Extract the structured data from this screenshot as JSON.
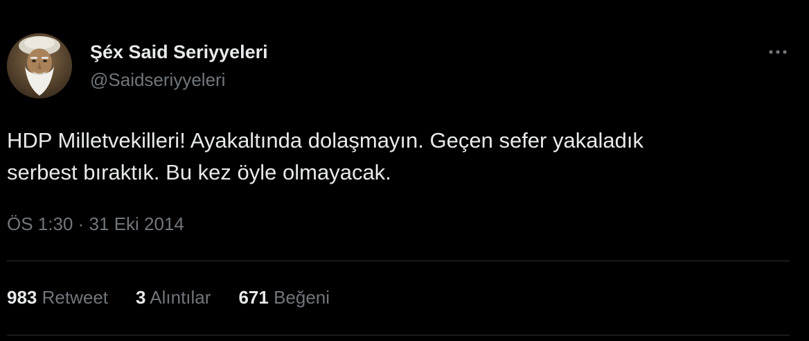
{
  "author": {
    "name": "Şéx Said Seriyyeleri",
    "handle": "@Saidseriyyeleri"
  },
  "tweet": {
    "text_line1": "HDP Milletvekilleri! Ayakaltında dolaşmayın. Geçen sefer yakaladık",
    "text_line2": "serbest bıraktık. Bu kez öyle olmayacak."
  },
  "meta": {
    "time": "ÖS 1:30",
    "separator": "·",
    "date": "31 Eki 2014"
  },
  "stats": {
    "retweets": {
      "count": "983",
      "label": "Retweet"
    },
    "quotes": {
      "count": "3",
      "label": "Alıntılar"
    },
    "likes": {
      "count": "671",
      "label": "Beğeni"
    }
  },
  "icons": {
    "more": "more-horizontal-icon"
  },
  "colors": {
    "background": "#000000",
    "primary_text": "#e7e9ea",
    "secondary_text": "#71767b",
    "divider": "#2f3336"
  }
}
